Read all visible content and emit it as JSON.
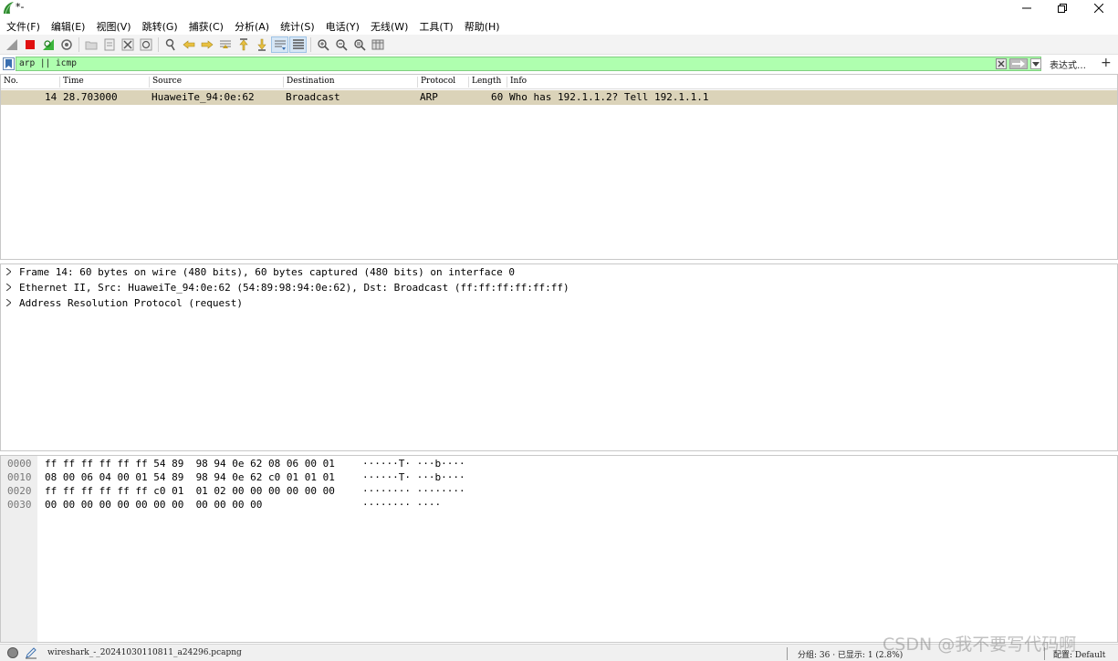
{
  "window": {
    "title": "*-",
    "controls": [
      "minimize",
      "restore",
      "close"
    ]
  },
  "menu": [
    "文件(F)",
    "编辑(E)",
    "视图(V)",
    "跳转(G)",
    "捕获(C)",
    "分析(A)",
    "统计(S)",
    "电话(Y)",
    "无线(W)",
    "工具(T)",
    "帮助(H)"
  ],
  "toolbar": {
    "icons": [
      "shark-fin-start-icon",
      "stop-icon",
      "restart-icon",
      "options-icon",
      "open-icon",
      "save-icon",
      "close-file-icon",
      "reload-icon",
      "find-icon",
      "back-icon",
      "forward-icon",
      "goto-icon",
      "first-icon",
      "last-icon",
      "autoscroll-icon",
      "colorize-icon",
      "zoom-in-icon",
      "zoom-out-icon",
      "zoom-normal-icon",
      "resize-columns-icon"
    ]
  },
  "filter": {
    "value": "arp || icmp",
    "expression_label": "表达式…",
    "add_label": "+"
  },
  "packet_list": {
    "columns": [
      "No.",
      "Time",
      "Source",
      "Destination",
      "Protocol",
      "Length",
      "Info"
    ],
    "rows": [
      {
        "no": "14",
        "time": "28.703000",
        "source": "HuaweiTe_94:0e:62",
        "destination": "Broadcast",
        "protocol": "ARP",
        "length": "60",
        "info": "Who has 192.1.1.2? Tell 192.1.1.1"
      }
    ],
    "row_color": "#dbd3b9"
  },
  "details": [
    "Frame 14: 60 bytes on wire (480 bits), 60 bytes captured (480 bits) on interface 0",
    "Ethernet II, Src: HuaweiTe_94:0e:62 (54:89:98:94:0e:62), Dst: Broadcast (ff:ff:ff:ff:ff:ff)",
    "Address Resolution Protocol (request)"
  ],
  "bytes": [
    {
      "offset": "0000",
      "hex": "ff ff ff ff ff ff 54 89  98 94 0e 62 08 06 00 01",
      "ascii": "······T· ···b····"
    },
    {
      "offset": "0010",
      "hex": "08 00 06 04 00 01 54 89  98 94 0e 62 c0 01 01 01",
      "ascii": "······T· ···b····"
    },
    {
      "offset": "0020",
      "hex": "ff ff ff ff ff ff c0 01  01 02 00 00 00 00 00 00",
      "ascii": "········ ········"
    },
    {
      "offset": "0030",
      "hex": "00 00 00 00 00 00 00 00  00 00 00 00",
      "ascii": "········ ····"
    }
  ],
  "status": {
    "file": "wireshark_-_20241030110811_a24296.pcapng",
    "packets": "分组: 36 · 已显示: 1 (2.8%)",
    "profile": "配置: Default"
  },
  "watermark": "CSDN @我不要写代码啊",
  "colors": {
    "filter_valid": "#afffaf",
    "accent": "#d6e6f5"
  }
}
